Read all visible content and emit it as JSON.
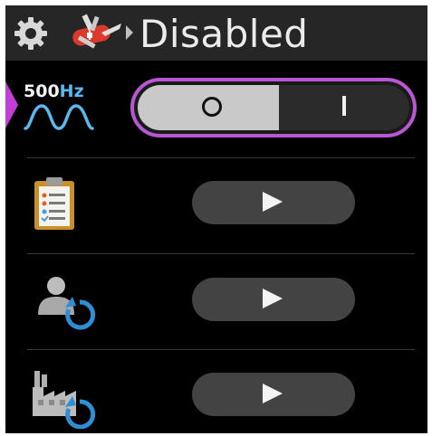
{
  "header": {
    "title": "Disabled",
    "icons": [
      "gear-icon",
      "swiss-army-knife-icon",
      "breadcrumb-arrow-icon"
    ]
  },
  "rows": [
    {
      "icon": "sine-wave-500hz-icon",
      "label_value": "500",
      "label_unit": "Hz",
      "control": "toggle",
      "toggle": {
        "off_symbol": "O",
        "on_symbol": "I",
        "state": "off"
      }
    },
    {
      "icon": "checklist-clipboard-icon",
      "control": "play-button",
      "action_icon": "play-icon"
    },
    {
      "icon": "reset-user-icon",
      "control": "play-button",
      "action_icon": "play-icon"
    },
    {
      "icon": "reset-factory-icon",
      "control": "play-button",
      "action_icon": "play-icon"
    }
  ],
  "colors": {
    "accent": "#b856d4",
    "header_bg": "#262626",
    "background": "#000000",
    "button_bg": "#434343",
    "hz_unit": "#59b8f0",
    "reset_arrow": "#2f8fd6"
  }
}
